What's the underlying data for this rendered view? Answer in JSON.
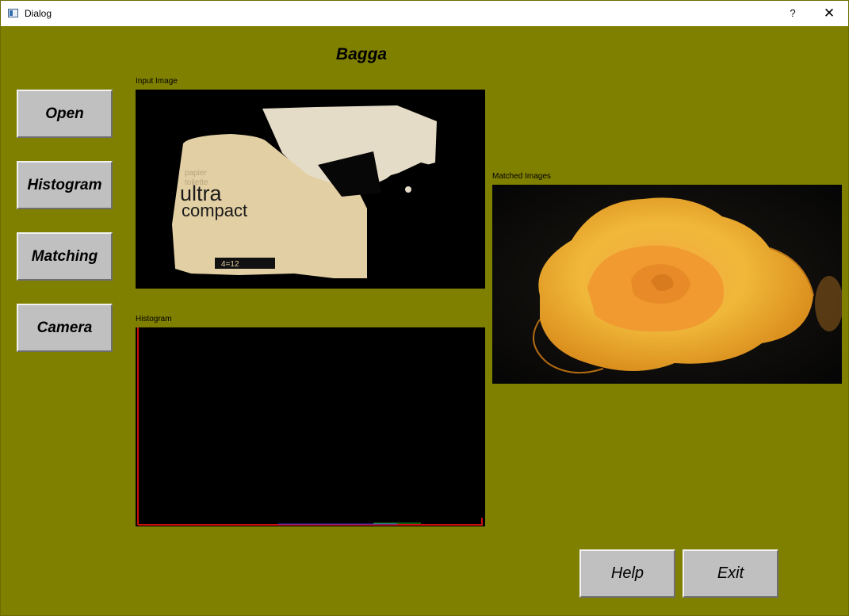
{
  "window": {
    "title": "Dialog",
    "help_label": "?",
    "close_label": "✕"
  },
  "heading": "Bagga",
  "buttons": {
    "open": "Open",
    "histogram": "Histogram",
    "matching": "Matching",
    "camera": "Camera",
    "help": "Help",
    "exit": "Exit"
  },
  "labels": {
    "input_image": "Input Image",
    "histogram": "Histogram",
    "matched_images": "Matched Images"
  },
  "input_image": {
    "line1": "ultra",
    "line2": "compact",
    "small1": "papier",
    "small2": "toilette",
    "badge": "4=12"
  },
  "colors": {
    "background": "#808000",
    "button": "#c0c0c0",
    "panel": "#000000"
  }
}
